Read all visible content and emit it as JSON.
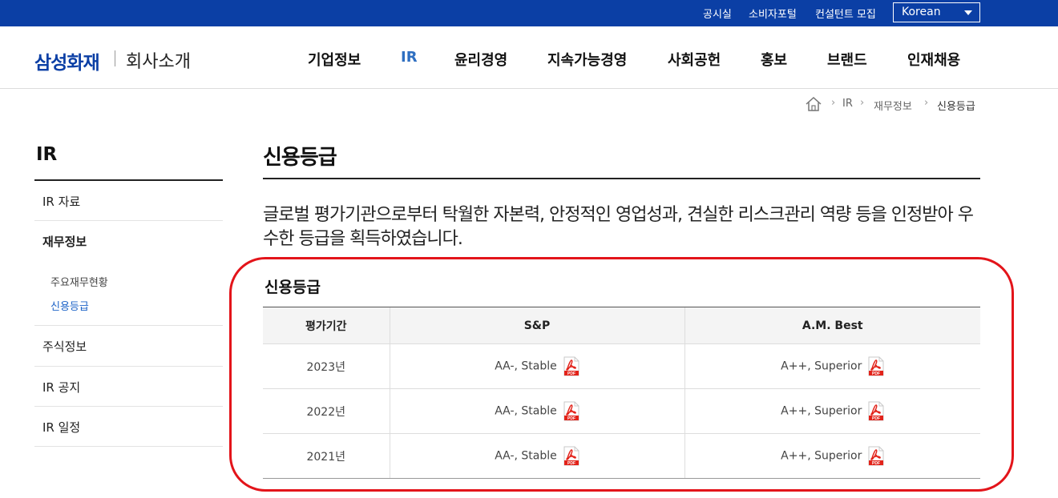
{
  "utility": {
    "links": [
      "공시실",
      "소비자포털",
      "컨설턴트 모집"
    ],
    "language": "Korean"
  },
  "header": {
    "logo": "삼성화재",
    "site_title": "회사소개",
    "nav": [
      "기업정보",
      "IR",
      "윤리경영",
      "지속가능경영",
      "사회공헌",
      "홍보",
      "브랜드",
      "인재채용"
    ],
    "active_nav": "IR"
  },
  "breadcrumb": [
    "IR",
    "재무정보",
    "신용등급"
  ],
  "sidebar": {
    "title": "IR",
    "items": [
      {
        "label": "IR 자료"
      },
      {
        "label": "재무정보",
        "sub": [
          "주요재무현황",
          "신용등급"
        ],
        "active_sub": "신용등급"
      },
      {
        "label": "주식정보"
      },
      {
        "label": "IR 공지"
      },
      {
        "label": "IR 일정"
      }
    ]
  },
  "main": {
    "title": "신용등급",
    "intro": "글로벌 평가기관으로부터 탁월한 자본력, 안정적인 영업성과, 견실한 리스크관리 역량 등을 인정받아 우수한 등급을 획득하였습니다.",
    "section_title": "신용등급",
    "table": {
      "headers": [
        "평가기간",
        "S&P",
        "A.M. Best"
      ],
      "rows": [
        [
          "2023년",
          "AA-, Stable",
          "A++, Superior"
        ],
        [
          "2022년",
          "AA-, Stable",
          "A++, Superior"
        ],
        [
          "2021년",
          "AA-, Stable",
          "A++, Superior"
        ]
      ]
    }
  },
  "icons": {
    "pdf_label": "PDF"
  },
  "colors": {
    "brand_blue": "#0b3fa5",
    "active_nav": "#2f6fc1",
    "highlight_red": "#e3141a"
  }
}
